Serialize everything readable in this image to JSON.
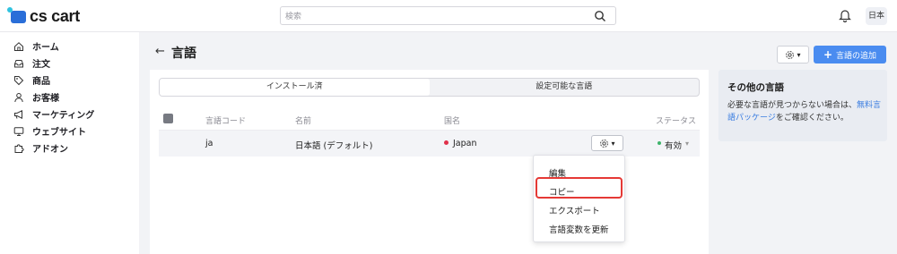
{
  "header": {
    "logo_text": "cs cart",
    "search_placeholder": "検索",
    "language_badge": "日本"
  },
  "sidebar": {
    "items": [
      {
        "label": "ホーム",
        "icon": "home-icon"
      },
      {
        "label": "注文",
        "icon": "inbox-icon"
      },
      {
        "label": "商品",
        "icon": "tag-icon"
      },
      {
        "label": "お客様",
        "icon": "user-icon"
      },
      {
        "label": "マーケティング",
        "icon": "megaphone-icon"
      },
      {
        "label": "ウェブサイト",
        "icon": "monitor-icon"
      },
      {
        "label": "アドオン",
        "icon": "puzzle-icon"
      }
    ]
  },
  "page": {
    "title": "言語",
    "add_button": "言語の追加"
  },
  "tabs": [
    {
      "label": "インストール済",
      "active": true
    },
    {
      "label": "設定可能な言語",
      "active": false
    }
  ],
  "table": {
    "columns": [
      "言語コード",
      "名前",
      "国名",
      "ステータス"
    ],
    "rows": [
      {
        "code": "ja",
        "name": "日本語 (デフォルト)",
        "country": "Japan",
        "status": "有効"
      }
    ]
  },
  "dropdown": {
    "items": [
      "編集",
      "コピー",
      "エクスポート",
      "言語変数を更新"
    ],
    "highlighted": "コピー"
  },
  "side_card": {
    "title": "その他の言語",
    "text_before": "必要な言語が見つからない場合は、",
    "link": "無料言語パッケージ",
    "text_after": "をご確認ください。"
  },
  "colors": {
    "accent": "#4a8cf0",
    "highlight_border": "#e53935",
    "status_active": "#3db36b",
    "link": "#3a7de0"
  }
}
